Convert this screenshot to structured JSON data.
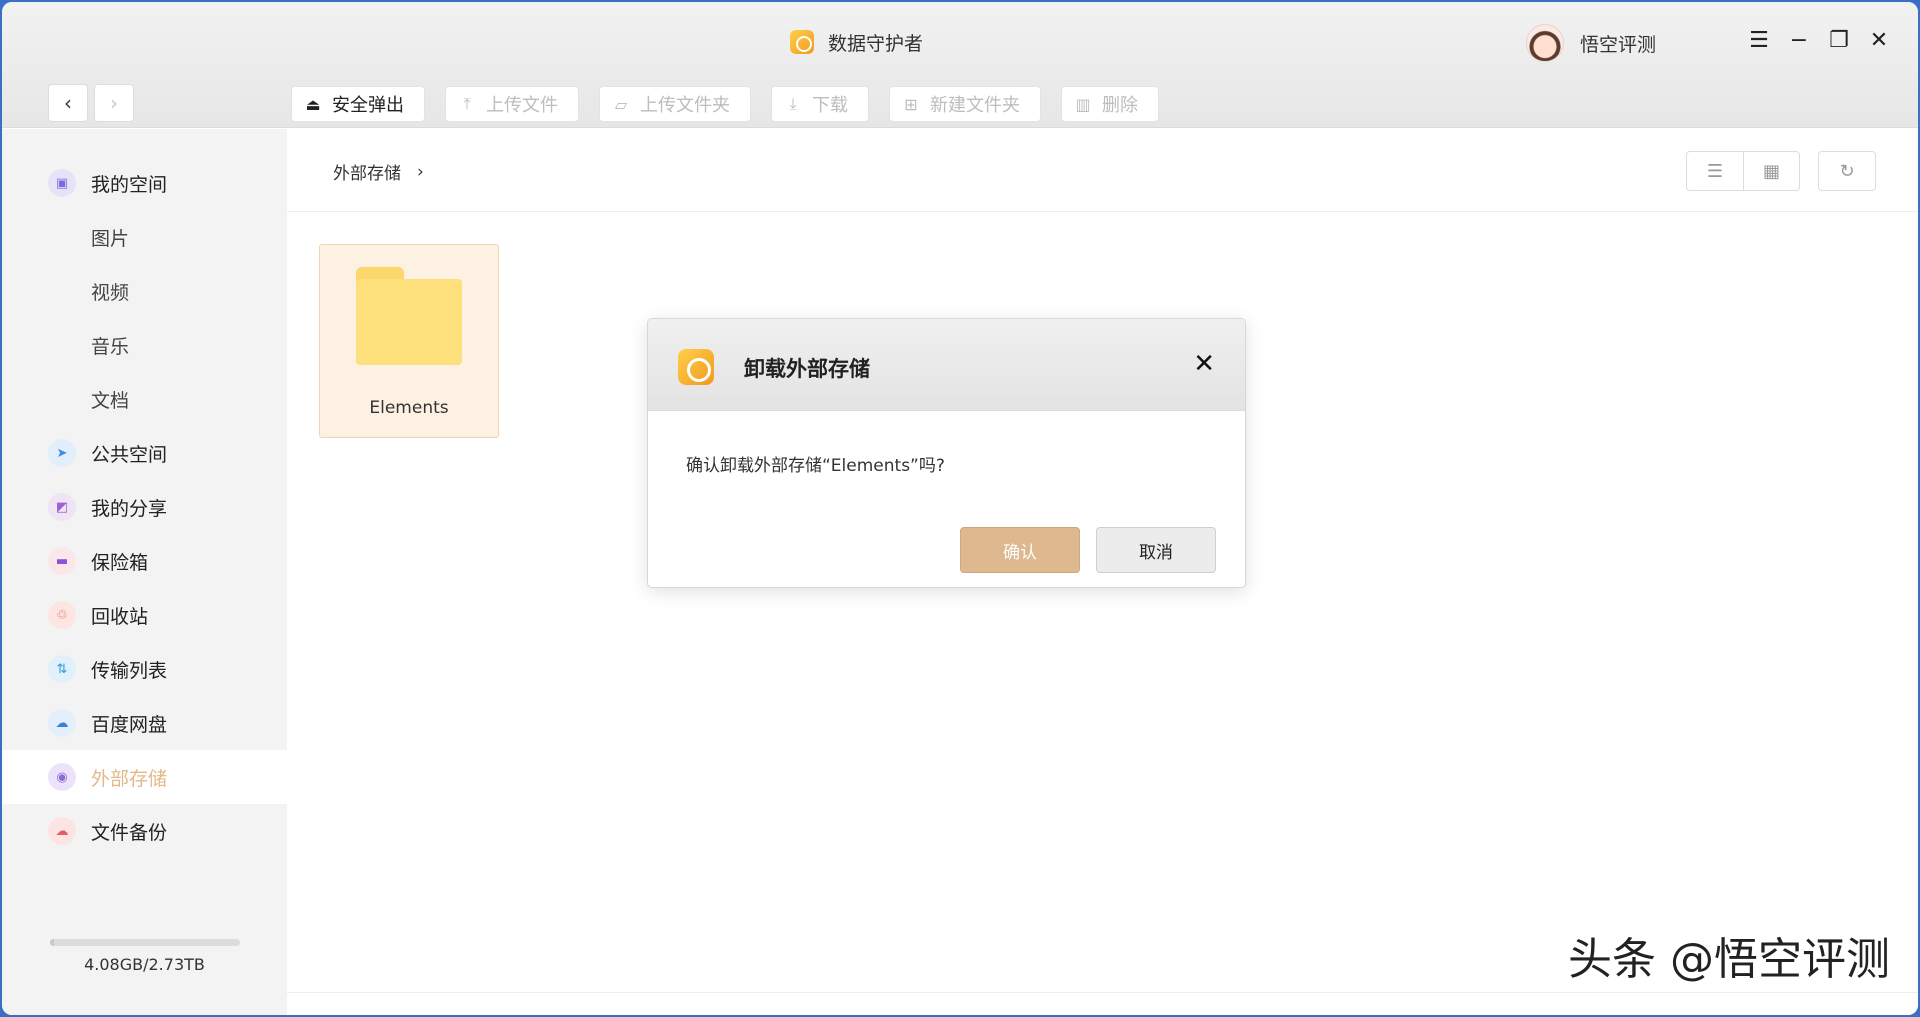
{
  "app": {
    "title": "数据守护者",
    "user_name": "悟空评测"
  },
  "toolbar": {
    "buttons": [
      {
        "label": "安全弹出",
        "icon": "eject-icon",
        "enabled": true
      },
      {
        "label": "上传文件",
        "icon": "upload-icon",
        "enabled": false
      },
      {
        "label": "上传文件夹",
        "icon": "upload-folder-icon",
        "enabled": false
      },
      {
        "label": "下载",
        "icon": "download-icon",
        "enabled": false
      },
      {
        "label": "新建文件夹",
        "icon": "new-folder-icon",
        "enabled": false
      },
      {
        "label": "删除",
        "icon": "trash-icon",
        "enabled": false
      }
    ]
  },
  "sidebar": {
    "items": [
      {
        "label": "我的空间",
        "icon": "my-space-icon",
        "has_icon": true
      },
      {
        "label": "图片",
        "has_icon": false
      },
      {
        "label": "视频",
        "has_icon": false
      },
      {
        "label": "音乐",
        "has_icon": false
      },
      {
        "label": "文档",
        "has_icon": false
      },
      {
        "label": "公共空间",
        "icon": "paper-plane-icon",
        "has_icon": true
      },
      {
        "label": "我的分享",
        "icon": "share-icon",
        "has_icon": true
      },
      {
        "label": "保险箱",
        "icon": "safe-icon",
        "has_icon": true
      },
      {
        "label": "回收站",
        "icon": "recycle-bin-icon",
        "has_icon": true
      },
      {
        "label": "传输列表",
        "icon": "transfer-icon",
        "has_icon": true
      },
      {
        "label": "百度网盘",
        "icon": "baidu-cloud-icon",
        "has_icon": true
      },
      {
        "label": "外部存储",
        "icon": "external-storage-icon",
        "has_icon": true,
        "active": true
      },
      {
        "label": "文件备份",
        "icon": "backup-icon",
        "has_icon": true
      }
    ],
    "storage_text": "4.08GB/2.73TB",
    "storage_used_fraction": 0.0015
  },
  "main": {
    "breadcrumb": "外部存储",
    "folder_name": "Elements"
  },
  "dialog": {
    "title": "卸载外部存储",
    "message": "确认卸载外部存储“Elements”吗?",
    "ok_label": "确认",
    "cancel_label": "取消"
  },
  "watermark": "头条 @悟空评测",
  "colors": {
    "accent": "#deb88f",
    "active_text": "#e3b989",
    "folder": "#fde07c"
  }
}
